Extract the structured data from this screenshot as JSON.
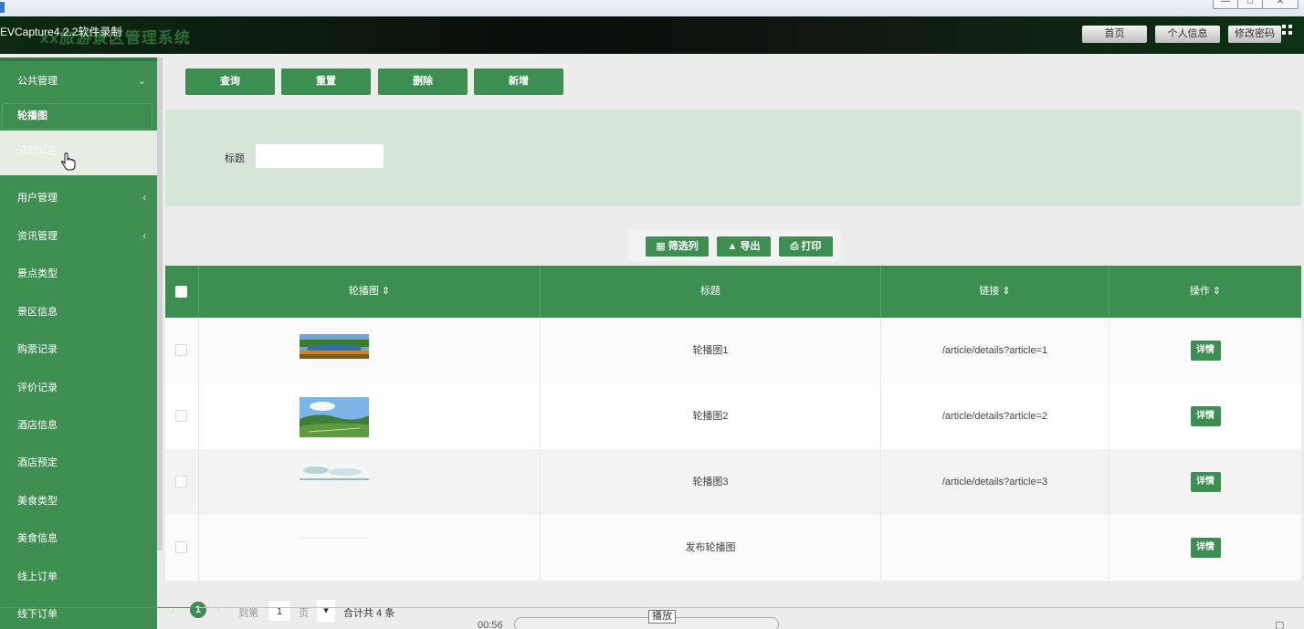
{
  "capture_title": "EVCapture4.2.2软件录制",
  "app": {
    "title": "xx旅游景区管理系统",
    "header_buttons": [
      "首页",
      "个人信息",
      "修改密码"
    ]
  },
  "sidebar": {
    "items": [
      {
        "label": "公共管理",
        "arrow": "chevron-down",
        "expanded": true
      },
      {
        "label": "用户管理",
        "arrow": "chevron-left"
      },
      {
        "label": "资讯管理",
        "arrow": "chevron-left"
      },
      {
        "label": "景点类型"
      },
      {
        "label": "景区信息"
      },
      {
        "label": "购票记录"
      },
      {
        "label": "评价记录"
      },
      {
        "label": "酒店信息"
      },
      {
        "label": "酒店预定"
      },
      {
        "label": "美食类型"
      },
      {
        "label": "美食信息"
      },
      {
        "label": "线上订单"
      },
      {
        "label": "线下订单"
      }
    ],
    "sub_items": [
      {
        "label": "轮播图",
        "active": true
      },
      {
        "label": "通知公告",
        "hover": true
      }
    ]
  },
  "actions": [
    "查询",
    "重置",
    "删除",
    "新增"
  ],
  "filter": {
    "title_label": "标题",
    "title_value": ""
  },
  "tools": [
    "筛选列",
    "导出",
    "打印"
  ],
  "table": {
    "columns": [
      "轮播图",
      "标题",
      "链接",
      "操作"
    ],
    "sortable": [
      true,
      false,
      true,
      true
    ],
    "rows": [
      {
        "title": "轮播图1",
        "link": "/article/details?article=1",
        "action": "详情",
        "image": "lake-landscape"
      },
      {
        "title": "轮播图2",
        "link": "/article/details?article=2",
        "action": "详情",
        "image": "grassland-landscape"
      },
      {
        "title": "轮播图3",
        "link": "/article/details?article=3",
        "action": "详情",
        "image": "sky-landscape"
      },
      {
        "title": "发布轮播图",
        "link": "",
        "action": "详情",
        "image": "blank"
      }
    ]
  },
  "pager": {
    "current_page": "1",
    "goto_prefix": "到第",
    "goto_value": "1",
    "page_suffix": "页",
    "total_text": "合计共 4 条"
  },
  "media_player": {
    "time": "00:56",
    "tooltip": "播放"
  },
  "colors": {
    "primary": "#3d8f51",
    "header": "#0b0f0b",
    "filter_bg": "#d5e6d8"
  }
}
